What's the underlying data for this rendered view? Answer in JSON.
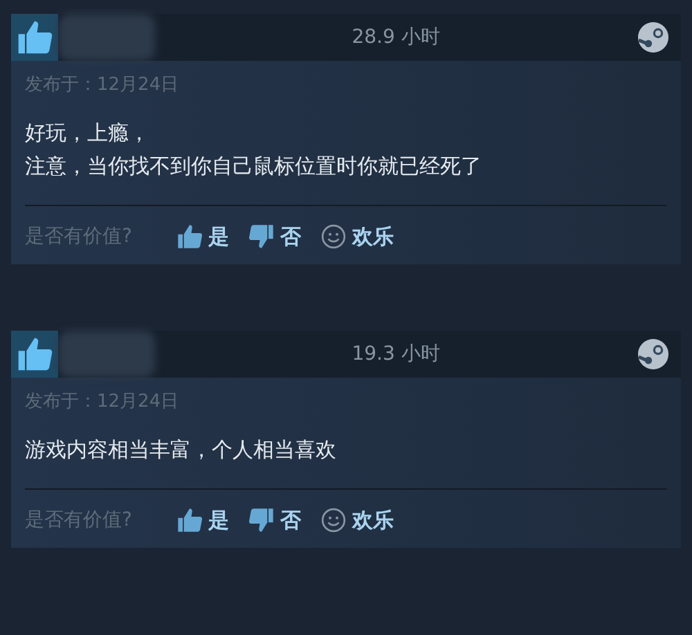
{
  "reviews": [
    {
      "recommended": true,
      "hours": "28.9 小时",
      "posted": "发布于：12月24日",
      "lines": [
        "好玩，上瘾，",
        "注意，当你找不到你自己鼠标位置时你就已经死了"
      ],
      "helpful_label": "是否有价值?",
      "votes": [
        {
          "kind": "up",
          "label": "是"
        },
        {
          "kind": "down",
          "label": "否"
        },
        {
          "kind": "funny",
          "label": "欢乐"
        }
      ]
    },
    {
      "recommended": true,
      "hours": "19.3 小时",
      "posted": "发布于：12月24日",
      "lines": [
        "游戏内容相当丰富，个人相当喜欢"
      ],
      "helpful_label": "是否有价值?",
      "votes": [
        {
          "kind": "up",
          "label": "是"
        },
        {
          "kind": "down",
          "label": "否"
        },
        {
          "kind": "funny",
          "label": "欢乐"
        }
      ]
    }
  ]
}
